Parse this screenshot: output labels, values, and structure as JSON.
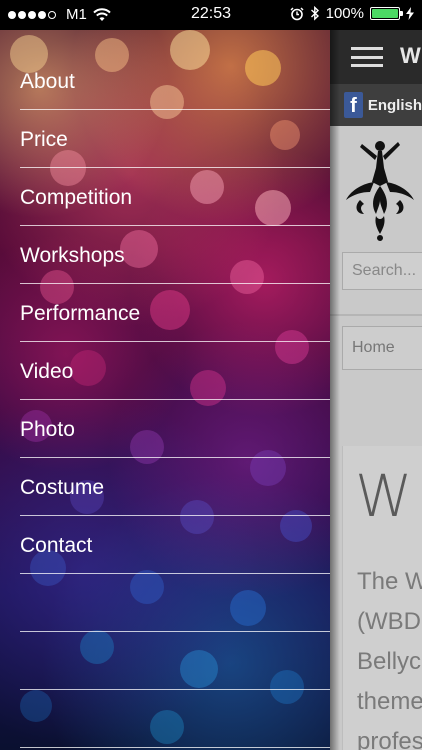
{
  "status_bar": {
    "carrier": "M1",
    "time": "22:53",
    "battery": "100%",
    "signal_bars_filled": 4,
    "signal_bars_total": 5,
    "battery_level": 1.0,
    "battery_color": "#4cd964"
  },
  "menu": {
    "items": [
      {
        "label": "About"
      },
      {
        "label": "Price"
      },
      {
        "label": "Competition"
      },
      {
        "label": "Workshops"
      },
      {
        "label": "Performance"
      },
      {
        "label": "Video"
      },
      {
        "label": "Photo"
      },
      {
        "label": "Costume"
      },
      {
        "label": "Contact"
      },
      {
        "label": ""
      },
      {
        "label": ""
      },
      {
        "label": ""
      }
    ]
  },
  "page": {
    "site_title_initial": "W",
    "language_label": "English",
    "search_placeholder": "Search...",
    "breadcrumb_home": "Home",
    "content_heading": "W",
    "content_lines": [
      "The W",
      "(WBD",
      "Bellyc",
      "theme",
      "profes"
    ]
  },
  "icons": {
    "menu": "hamburger-icon",
    "facebook": "facebook-icon",
    "wifi": "wifi-icon",
    "alarm": "alarm-icon",
    "bluetooth": "bluetooth-icon",
    "charging": "charging-bolt-icon",
    "logo": "dancer-logo-icon"
  },
  "colors": {
    "facebook": "#3b5998",
    "top_bar": "#2a2a2a",
    "page_background": "#c9c9c9"
  }
}
